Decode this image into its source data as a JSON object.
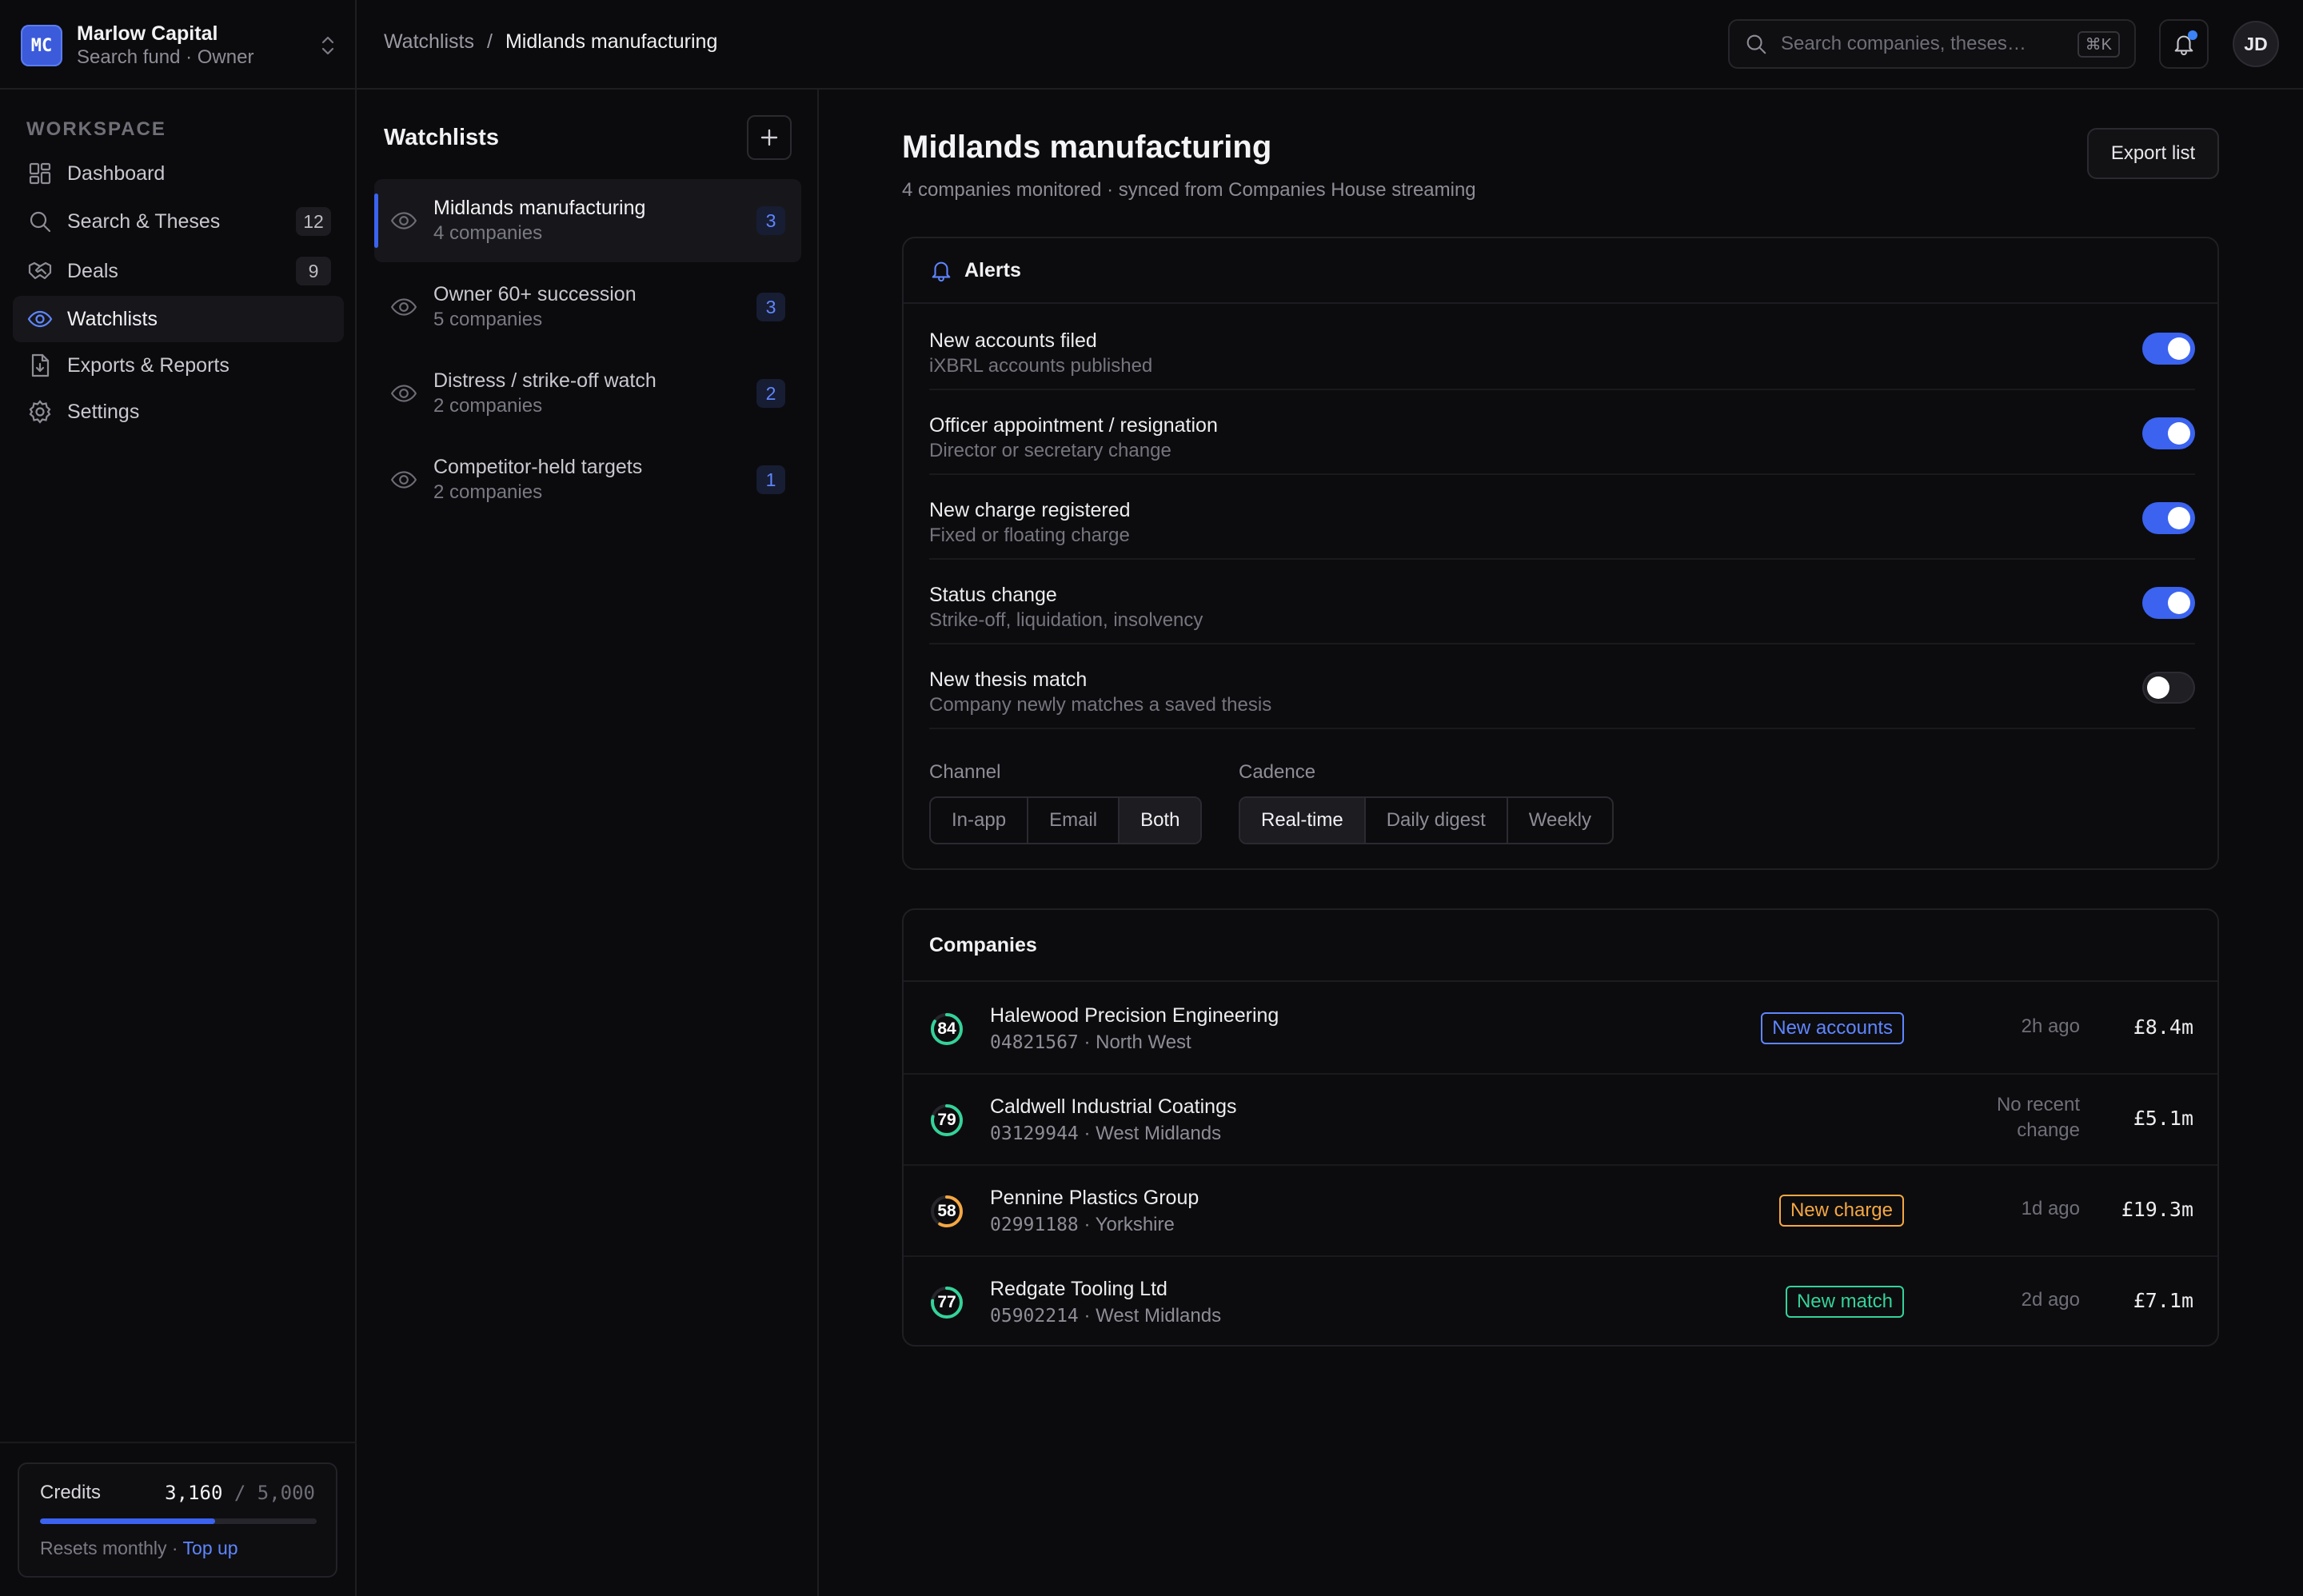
{
  "org": {
    "initials": "MC",
    "name": "Marlow Capital",
    "subtitle": "Search fund · Owner"
  },
  "sidebar": {
    "section_label": "WORKSPACE",
    "items": [
      {
        "label": "Dashboard",
        "icon": "dashboard-icon",
        "count": ""
      },
      {
        "label": "Search & Theses",
        "icon": "search-icon",
        "count": "12"
      },
      {
        "label": "Deals",
        "icon": "handshake-icon",
        "count": "9"
      },
      {
        "label": "Watchlists",
        "icon": "eye-icon",
        "count": "",
        "active": true
      },
      {
        "label": "Exports & Reports",
        "icon": "file-export-icon",
        "count": ""
      },
      {
        "label": "Settings",
        "icon": "gear-icon",
        "count": ""
      }
    ],
    "credits": {
      "label": "Credits",
      "used": "3,160",
      "total": "/ 5,000",
      "used_fraction": 0.632,
      "note": "Resets monthly ·",
      "top_up": "Top up"
    }
  },
  "topbar": {
    "breadcrumb": [
      "Watchlists",
      "/",
      "Midlands manufacturing"
    ],
    "search_placeholder": "Search companies, theses…",
    "shortcut": "⌘K",
    "user_initials": "JD"
  },
  "watchlists": {
    "title": "Watchlists",
    "items": [
      {
        "name": "Midlands manufacturing",
        "sub": "4 companies",
        "badge": "3",
        "active": true
      },
      {
        "name": "Owner 60+ succession",
        "sub": "5 companies",
        "badge": "3"
      },
      {
        "name": "Distress / strike-off watch",
        "sub": "2 companies",
        "badge": "2"
      },
      {
        "name": "Competitor-held targets",
        "sub": "2 companies",
        "badge": "1"
      }
    ]
  },
  "main": {
    "title": "Midlands manufacturing",
    "subtitle": "4 companies monitored · synced from Companies House streaming",
    "export_label": "Export list",
    "alerts": {
      "title": "Alerts",
      "rows": [
        {
          "name": "New accounts filed",
          "desc": "iXBRL accounts published",
          "on": true
        },
        {
          "name": "Officer appointment / resignation",
          "desc": "Director or secretary change",
          "on": true
        },
        {
          "name": "New charge registered",
          "desc": "Fixed or floating charge",
          "on": true
        },
        {
          "name": "Status change",
          "desc": "Strike-off, liquidation, insolvency",
          "on": true
        },
        {
          "name": "New thesis match",
          "desc": "Company newly matches a saved thesis",
          "on": false
        }
      ],
      "channel": {
        "label": "Channel",
        "options": [
          "In-app",
          "Email",
          "Both"
        ],
        "selected": "Both"
      },
      "cadence": {
        "label": "Cadence",
        "options": [
          "Real-time",
          "Daily digest",
          "Weekly"
        ],
        "selected": "Real-time"
      }
    },
    "companies": {
      "title": "Companies",
      "rows": [
        {
          "score": "84",
          "score_color": "#34d399",
          "name": "Halewood Precision Engineering",
          "number": "04821567",
          "region": "· North West",
          "tag": "New accounts",
          "tag_color": "#5f86ff",
          "when": "2h ago",
          "value": "£8.4m"
        },
        {
          "score": "79",
          "score_color": "#34d399",
          "name": "Caldwell Industrial Coatings",
          "number": "03129944",
          "region": "· West Midlands",
          "tag": "",
          "tag_color": "",
          "when": "No recent change",
          "value": "£5.1m"
        },
        {
          "score": "58",
          "score_color": "#f5a742",
          "name": "Pennine Plastics Group",
          "number": "02991188",
          "region": "· Yorkshire",
          "tag": "New charge",
          "tag_color": "#f5a742",
          "when": "1d ago",
          "value": "£19.3m"
        },
        {
          "score": "77",
          "score_color": "#34d399",
          "name": "Redgate Tooling Ltd",
          "number": "05902214",
          "region": "· West Midlands",
          "tag": "New match",
          "tag_color": "#34d399",
          "when": "2d ago",
          "value": "£7.1m"
        }
      ]
    }
  }
}
